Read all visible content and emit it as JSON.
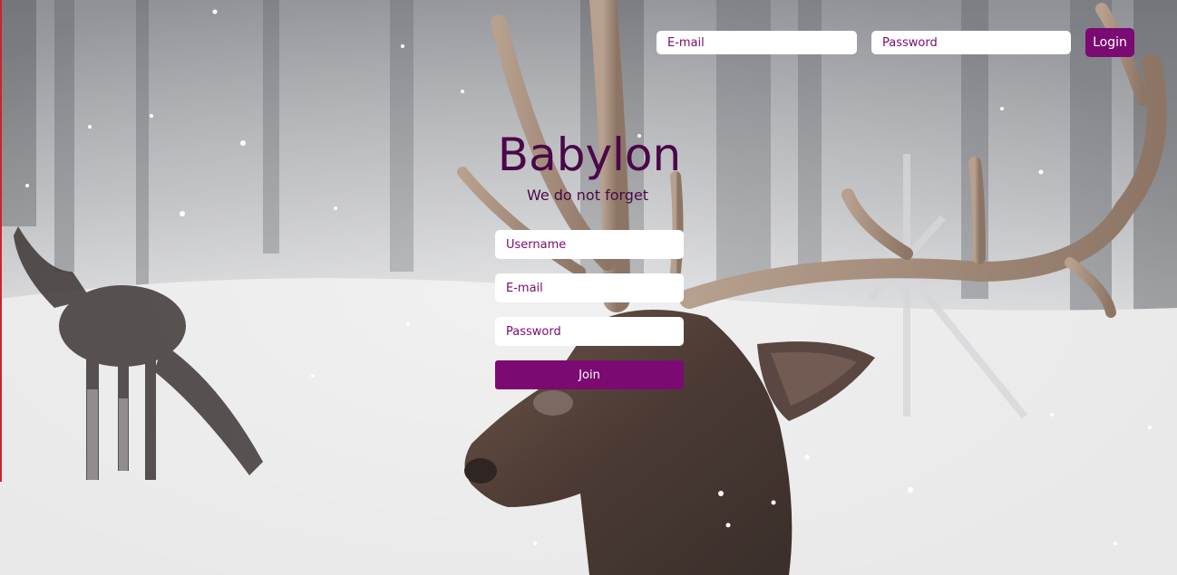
{
  "header": {
    "email_placeholder": "E-mail",
    "password_placeholder": "Password",
    "login_label": "Login"
  },
  "brand": {
    "title": "Babylon",
    "tagline": "We do not forget"
  },
  "signup": {
    "username_placeholder": "Username",
    "email_placeholder": "E-mail",
    "password_placeholder": "Password",
    "join_label": "Join"
  },
  "colors": {
    "accent": "#7b0a73",
    "title_text": "#4a0848",
    "placeholder_text": "#7a0a6e",
    "left_edge": "#d0222a"
  }
}
